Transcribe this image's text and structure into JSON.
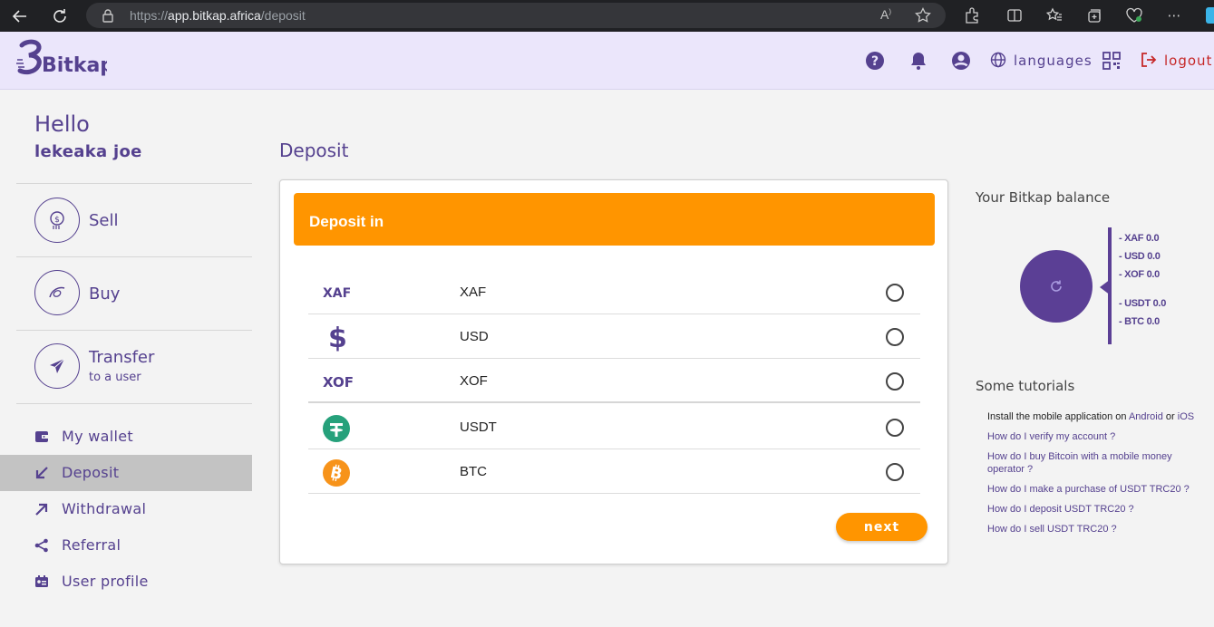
{
  "browser": {
    "url_scheme": "https://",
    "url_host": "app.bitkap.africa",
    "url_path": "/deposit"
  },
  "header": {
    "logo_text": "Bitkap",
    "languages_label": "languages",
    "logout_label": "logout"
  },
  "sidebar": {
    "greeting": "Hello",
    "username": "lekeaka joe",
    "actions": [
      {
        "label": "Sell",
        "sub": ""
      },
      {
        "label": "Buy",
        "sub": ""
      },
      {
        "label": "Transfer",
        "sub": "to a user"
      }
    ],
    "menu": [
      {
        "label": "My wallet"
      },
      {
        "label": "Deposit"
      },
      {
        "label": "Withdrawal"
      },
      {
        "label": "Referral"
      },
      {
        "label": "User profile"
      }
    ]
  },
  "main": {
    "page_title": "Deposit",
    "card_title": "Deposit in",
    "currencies": [
      {
        "code_icon": "XAF",
        "name": "XAF",
        "selected": false
      },
      {
        "code_icon": "$",
        "name": "USD",
        "selected": false
      },
      {
        "code_icon": "XOF",
        "name": "XOF",
        "selected": false
      },
      {
        "code_icon": "tether-icon",
        "name": "USDT",
        "selected": false
      },
      {
        "code_icon": "bitcoin-icon",
        "name": "BTC",
        "selected": false
      }
    ],
    "next_label": "next"
  },
  "right_panel": {
    "balance_title": "Your Bitkap balance",
    "balances": [
      "- XAF 0.0",
      "- USD 0.0",
      "- XOF 0.0",
      "- USDT 0.0",
      "- BTC 0.0"
    ],
    "tutorials_title": "Some tutorials",
    "tutorial_intro": "Install the mobile application on",
    "tutorial_android": "Android",
    "tutorial_or": "or",
    "tutorial_ios": "iOS",
    "tutorials": [
      "How do I verify my account ?",
      "How do I buy Bitcoin with a mobile money operator ?",
      "How do I make a purchase of USDT TRC20 ?",
      "How do I deposit USDT TRC20 ?",
      "How do I sell USDT TRC20 ?"
    ]
  },
  "colors": {
    "brand_purple": "#55418f",
    "accent_orange": "#ff9500",
    "logout_red": "#c62828",
    "header_bg": "#ebe6fb"
  }
}
